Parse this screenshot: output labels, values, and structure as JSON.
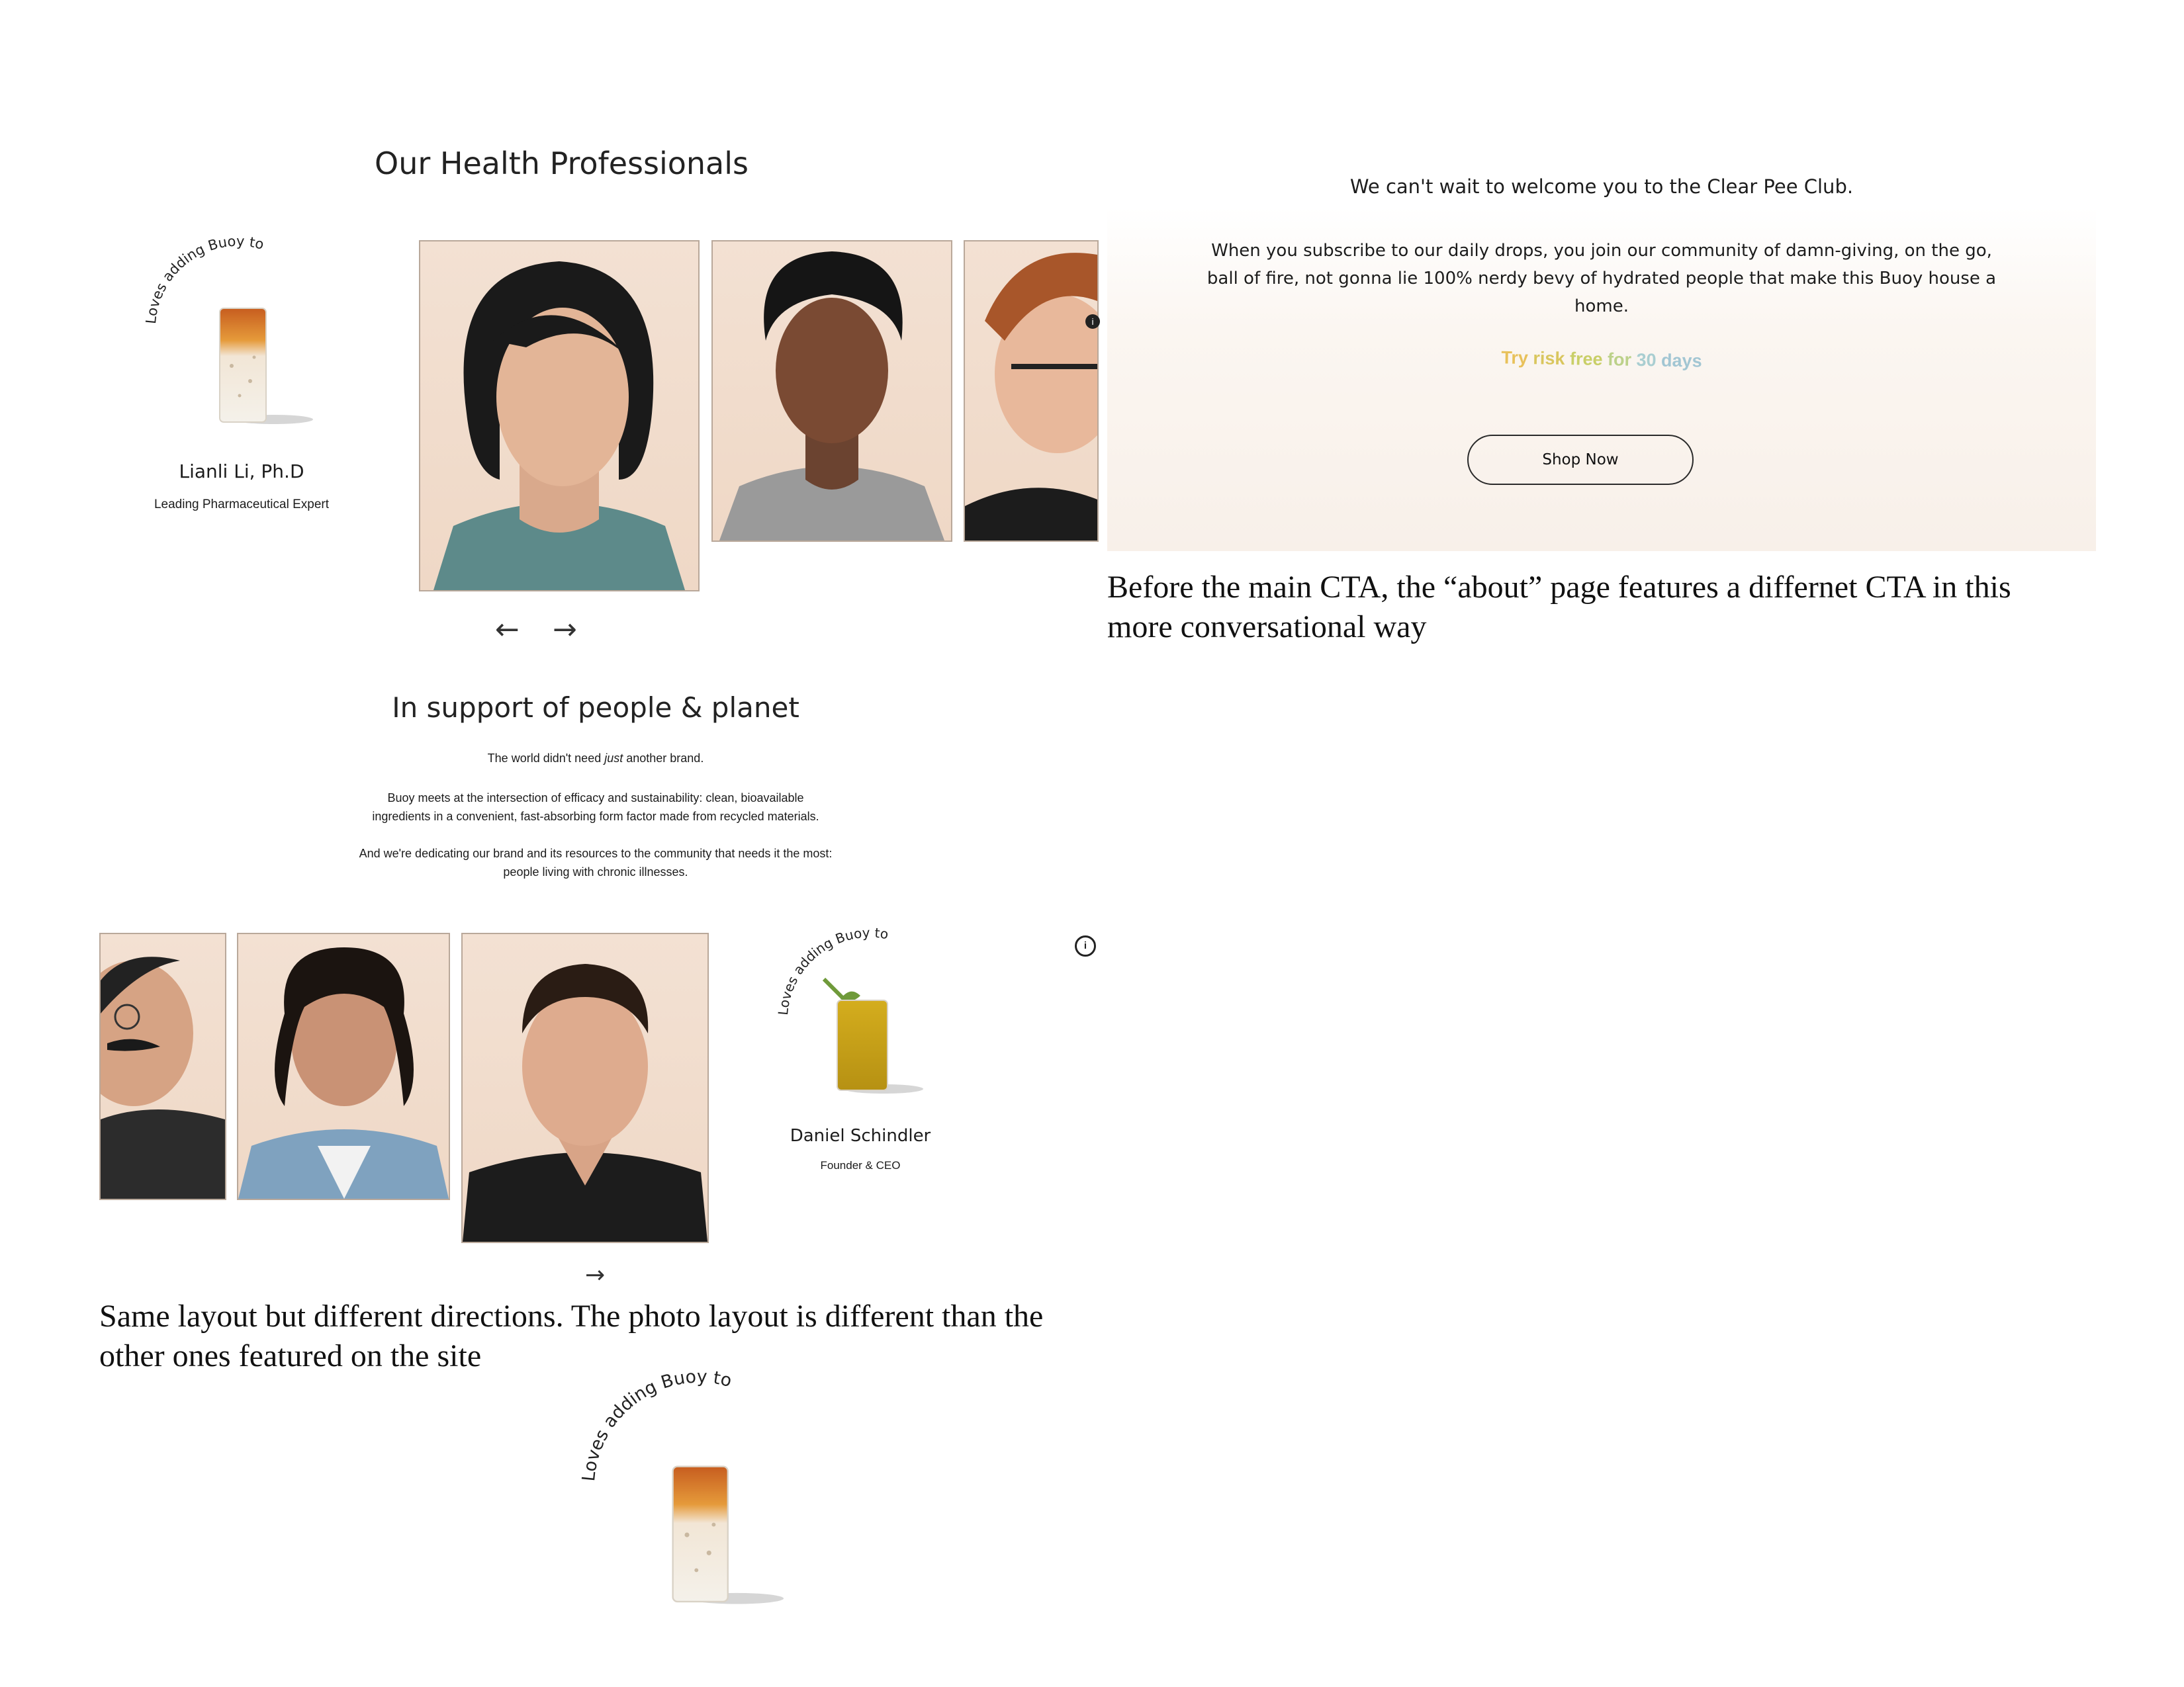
{
  "left_top": {
    "heading": "Our Health Professionals",
    "curved_label": "Loves adding Buoy to",
    "name": "Lianli Li, Ph.D",
    "role": "Leading Pharmaceutical Expert",
    "prev_arrow": "←",
    "next_arrow": "→"
  },
  "support": {
    "heading": "In support of people & planet",
    "line1_before": "The world didn't need ",
    "line1_em": "just",
    "line1_after": " another brand.",
    "para2_line1": "Buoy meets at the intersection of efficacy and sustainability: clean, bioavailable",
    "para2_line2": "ingredients in a convenient, fast-absorbing form factor made from recycled materials.",
    "para3_line1": "And we're dedicating our brand and its resources to the community that needs it the most:",
    "para3_line2": "people living with chronic illnesses."
  },
  "bottom_card": {
    "curved_label": "Loves adding Buoy to",
    "name": "Daniel Schindler",
    "role": "Founder & CEO",
    "next_arrow": "→",
    "info_icon": "info-icon"
  },
  "cta": {
    "title": "We can't wait to welcome you to the Clear Pee Club.",
    "body_line1": "When you subscribe to our daily drops, you join our community of damn-giving, on the go,",
    "body_line2": "ball of fire, not gonna lie 100% nerdy bevy of hydrated people that make this Buoy house a",
    "body_line3": "home.",
    "try_words": [
      "Try",
      "risk",
      "free",
      "for",
      "30",
      "days"
    ],
    "try_colors": [
      "#e8c15a",
      "#d9c65e",
      "#c9cf68",
      "#bcd18a",
      "#a9ced1",
      "#a2c6d3"
    ],
    "button": "Shop Now"
  },
  "annotations": {
    "right_note_line1": "Before the main CTA, the “about” page features a differnet CTA in this",
    "right_note_line2": "more conversational way",
    "left_note_line1": "Same layout but different directions. The photo layout is different than the",
    "left_note_line2": "other ones featured on the site"
  },
  "bottom_graphic": {
    "curved_label": "Loves adding Buoy to"
  }
}
